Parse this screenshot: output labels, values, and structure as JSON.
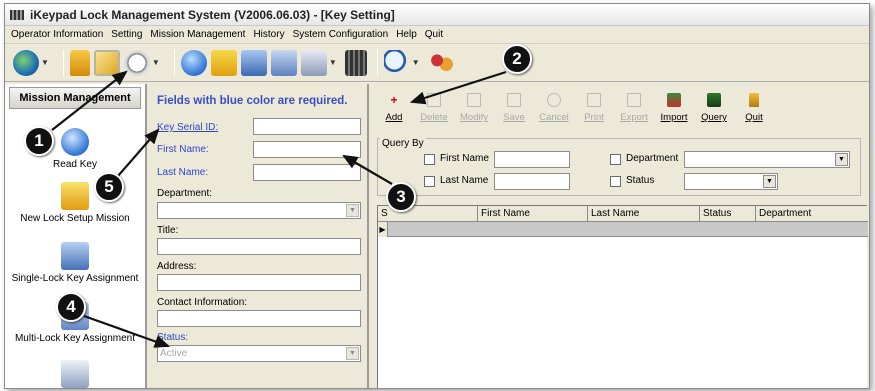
{
  "window": {
    "title": "iKeypad Lock Management System   (V2006.06.03) - [Key Setting]"
  },
  "menu": [
    "Operator Information",
    "Setting",
    "Mission Management",
    "History",
    "System Configuration",
    "Help",
    "Quit"
  ],
  "left_panel": {
    "header": "Mission Management",
    "items": [
      "Read Key",
      "New Lock Setup Mission",
      "Single-Lock Key Assignment",
      "Multi-Lock Key Assignment"
    ]
  },
  "form": {
    "required_note": "Fields with blue color are required.",
    "key_serial_label": "Key Serial ID:",
    "first_name_label": "First Name:",
    "last_name_label": "Last Name:",
    "department_label": "Department:",
    "title_label": "Title:",
    "address_label": "Address:",
    "contact_label": "Contact Information:",
    "status_label": "Status:",
    "status_value": "Active"
  },
  "actions": [
    {
      "label": "Add",
      "enabled": true
    },
    {
      "label": "Delete",
      "enabled": false
    },
    {
      "label": "Modify",
      "enabled": false
    },
    {
      "label": "Save",
      "enabled": false
    },
    {
      "label": "Cancel",
      "enabled": false
    },
    {
      "label": "Print",
      "enabled": false
    },
    {
      "label": "Export",
      "enabled": false
    },
    {
      "label": "Import",
      "enabled": true
    },
    {
      "label": "Query",
      "enabled": true
    },
    {
      "label": "Quit",
      "enabled": true
    }
  ],
  "query": {
    "title": "Query By",
    "first_name": "First Name",
    "last_name": "Last Name",
    "department": "Department",
    "status": "Status"
  },
  "grid": {
    "columns": [
      "S",
      "First Name",
      "Last Name",
      "Status",
      "Department"
    ]
  },
  "callouts": [
    "1",
    "2",
    "3",
    "4",
    "5"
  ],
  "colors": {
    "required_blue": "#3a4fc0",
    "window_bg": "#ece9d8"
  }
}
